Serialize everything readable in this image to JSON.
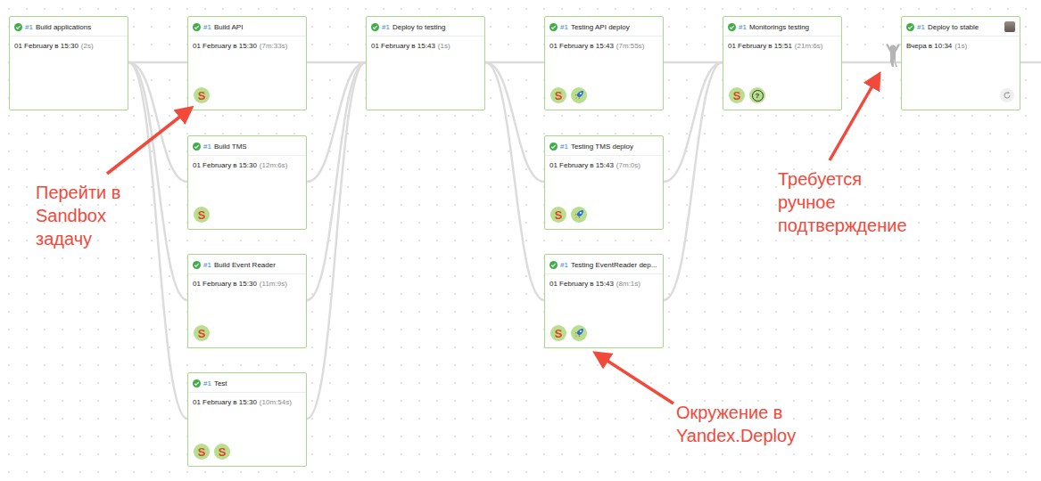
{
  "pipeline": {
    "nodes": [
      {
        "run": "#1",
        "title": "Build applications",
        "status": "success",
        "date": "01 February в 15:30",
        "duration": "(2s)",
        "badges": [],
        "avatar": false,
        "restart": false
      },
      {
        "run": "#1",
        "title": "Build API",
        "status": "success",
        "date": "01 February в 15:30",
        "duration": "(7m:33s)",
        "badges": [
          {
            "kind": "sandbox",
            "glyph": "S"
          }
        ],
        "avatar": false,
        "restart": false
      },
      {
        "run": "#1",
        "title": "Build TMS",
        "status": "success",
        "date": "01 February в 15:30",
        "duration": "(12m:6s)",
        "badges": [
          {
            "kind": "sandbox",
            "glyph": "S"
          }
        ],
        "avatar": false,
        "restart": false
      },
      {
        "run": "#1",
        "title": "Build Event Reader",
        "status": "success",
        "date": "01 February в 15:30",
        "duration": "(11m:9s)",
        "badges": [
          {
            "kind": "sandbox",
            "glyph": "S"
          }
        ],
        "avatar": false,
        "restart": false
      },
      {
        "run": "#1",
        "title": "Test",
        "status": "success",
        "date": "01 February в 15:30",
        "duration": "(10m:54s)",
        "badges": [
          {
            "kind": "sandbox",
            "glyph": "S"
          },
          {
            "kind": "sandbox",
            "glyph": "S"
          }
        ],
        "avatar": false,
        "restart": false
      },
      {
        "run": "#1",
        "title": "Deploy to testing",
        "status": "success",
        "date": "01 February в 15:43",
        "duration": "(1s)",
        "badges": [],
        "avatar": false,
        "restart": false
      },
      {
        "run": "#1",
        "title": "Testing API deploy",
        "status": "success",
        "date": "01 February в 15:43",
        "duration": "(7m:55s)",
        "badges": [
          {
            "kind": "sandbox",
            "glyph": "S"
          },
          {
            "kind": "deploy",
            "glyph": ""
          }
        ],
        "avatar": false,
        "restart": false
      },
      {
        "run": "#1",
        "title": "Testing TMS deploy",
        "status": "success",
        "date": "01 February в 15:43",
        "duration": "(7m:0s)",
        "badges": [
          {
            "kind": "sandbox",
            "glyph": "S"
          },
          {
            "kind": "deploy",
            "glyph": ""
          }
        ],
        "avatar": false,
        "restart": false
      },
      {
        "run": "#1",
        "title": "Testing EventReader dep...",
        "status": "success",
        "date": "01 February в 15:43",
        "duration": "(8m:1s)",
        "badges": [
          {
            "kind": "sandbox",
            "glyph": "S"
          },
          {
            "kind": "deploy",
            "glyph": ""
          }
        ],
        "avatar": false,
        "restart": false
      },
      {
        "run": "#1",
        "title": "Monitorings testing",
        "status": "success",
        "date": "01 February в 15:51",
        "duration": "(21m:6s)",
        "badges": [
          {
            "kind": "sandbox",
            "glyph": "S"
          },
          {
            "kind": "help",
            "glyph": "?"
          }
        ],
        "avatar": false,
        "restart": false
      },
      {
        "run": "#1",
        "title": "Deploy to stable",
        "status": "success",
        "date": "Вчера в 10:34",
        "duration": "(1s)",
        "badges": [],
        "avatar": true,
        "restart": true
      }
    ],
    "edges": [
      [
        0,
        1
      ],
      [
        0,
        2
      ],
      [
        0,
        3
      ],
      [
        0,
        4
      ],
      [
        1,
        5
      ],
      [
        2,
        5
      ],
      [
        3,
        5
      ],
      [
        4,
        5
      ],
      [
        5,
        6
      ],
      [
        5,
        7
      ],
      [
        5,
        8
      ],
      [
        6,
        9
      ],
      [
        7,
        9
      ],
      [
        8,
        9
      ],
      [
        9,
        10
      ]
    ],
    "manual_approval_before": 10
  },
  "annotations": [
    {
      "lines": [
        "Перейти в",
        "Sandbox",
        "задачу"
      ]
    },
    {
      "lines": [
        "Окружение в",
        "Yandex.Deploy"
      ]
    },
    {
      "lines": [
        "Требуется",
        "ручное",
        "подтверждение"
      ]
    }
  ]
}
